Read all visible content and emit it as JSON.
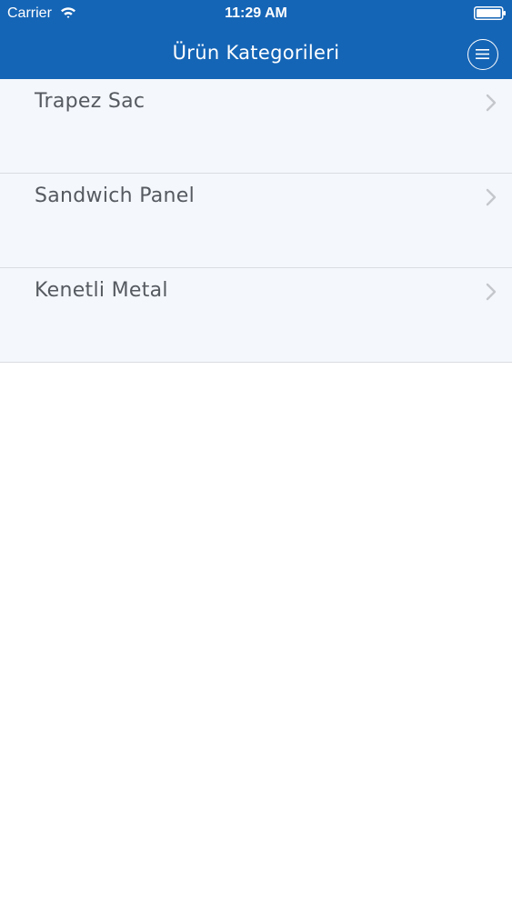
{
  "status_bar": {
    "carrier": "Carrier",
    "time": "11:29 AM",
    "icons": [
      "wifi-icon",
      "battery-icon"
    ]
  },
  "navbar": {
    "title": "Ürün Kategorileri",
    "menu_icon": "menu-icon",
    "background_color": "#1565b6"
  },
  "categories": [
    {
      "label": "Trapez Sac",
      "icon": "chevron-right-icon"
    },
    {
      "label": "Sandwich Panel",
      "icon": "chevron-right-icon"
    },
    {
      "label": "Kenetli Metal",
      "icon": "chevron-right-icon"
    }
  ]
}
